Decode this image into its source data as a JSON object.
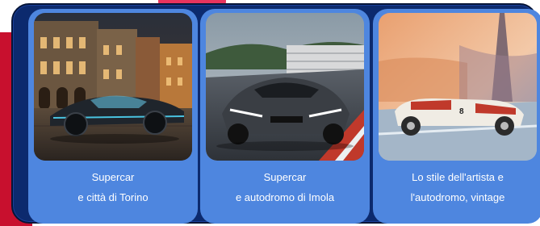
{
  "cards": [
    {
      "line1": "Supercar",
      "line2": "e città di Torino",
      "image": "supercar-in-turin-street-night"
    },
    {
      "line1": "Supercar",
      "line2": "e autodromo di Imola",
      "image": "supercar-on-imola-circuit"
    },
    {
      "line1": "Lo stile dell'artista e",
      "line2": "l'autodromo, vintage",
      "image": "vintage-race-car-painting"
    }
  ],
  "colors": {
    "panel": "#0c2a6e",
    "card": "#4e86df",
    "accent": "#c8102e"
  }
}
